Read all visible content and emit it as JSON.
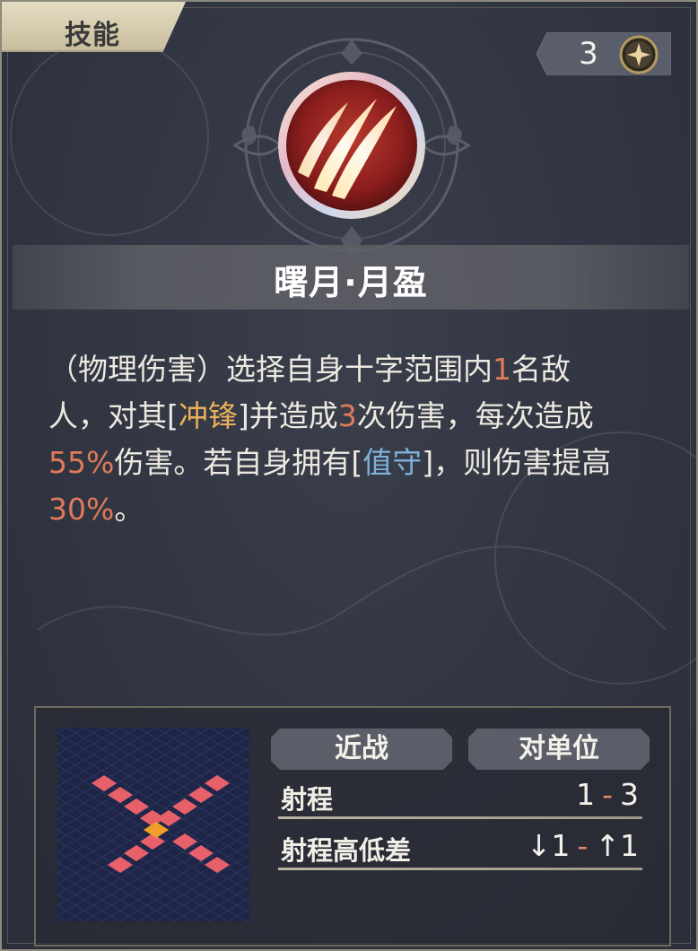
{
  "header": {
    "tab_label": "技能"
  },
  "cost": {
    "value": "3",
    "icon": "sparkle-star-icon"
  },
  "skill": {
    "icon": "claw-slash-icon",
    "name": "曙月·月盈"
  },
  "description": {
    "line1": {
      "a": "（物理伤害）选择自身十字范围内",
      "n1": "1",
      "b": "名敌"
    },
    "line2": {
      "a": "人，对其[",
      "kw": "冲锋",
      "b": "]并造成",
      "n": "3",
      "c": "次伤害，每次造成"
    },
    "line3": {
      "n": "55%",
      "a": "伤害。若自身拥有[",
      "kw": "值守",
      "b": "]，则伤害提高"
    },
    "line4": {
      "n": "30%",
      "a": "。"
    }
  },
  "info": {
    "range_icon": "cross-range-grid-icon",
    "tags": {
      "attack_type": "近战",
      "target_type": "对单位"
    },
    "stats": {
      "range": {
        "label": "射程",
        "min": "1",
        "dash": "-",
        "max": "3"
      },
      "height": {
        "label": "射程高低差",
        "down_arrow": "↓",
        "down": "1",
        "dash": "-",
        "up_arrow": "↑",
        "up": "1"
      }
    }
  },
  "colors": {
    "number_highlight": "#e07a5a",
    "keyword_gold": "#e9b25a",
    "keyword_blue": "#7fb1dc",
    "range_cell": "#e8606a",
    "range_center": "#f0a02a"
  }
}
